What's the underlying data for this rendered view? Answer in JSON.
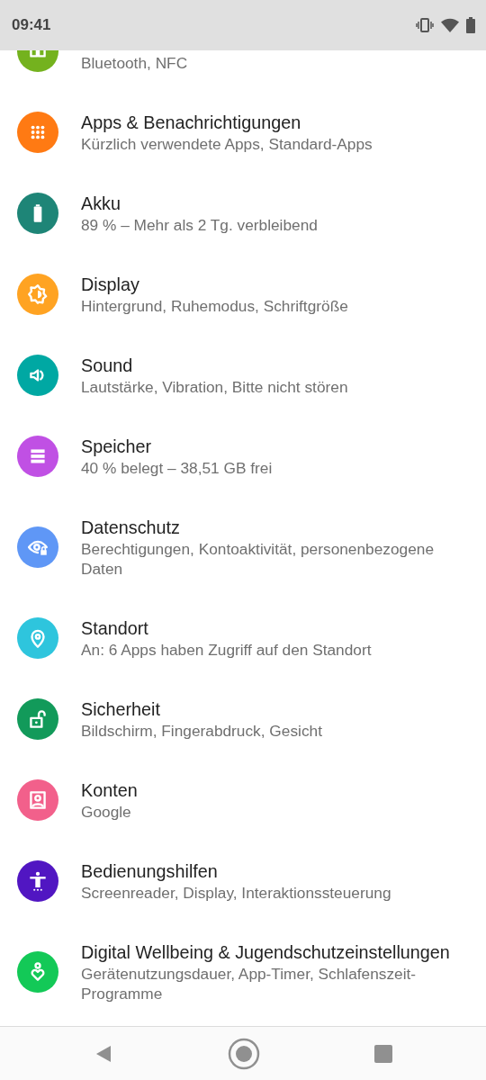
{
  "status_bar": {
    "time": "09:41"
  },
  "settings": [
    {
      "subtitle": "Bluetooth, NFC",
      "color": "#74b21e"
    },
    {
      "title": "Apps & Benachrichtigungen",
      "subtitle": "Kürzlich verwendete Apps, Standard-Apps",
      "color": "#ff7a13"
    },
    {
      "title": "Akku",
      "subtitle": "89 % – Mehr als 2 Tg. verbleibend",
      "color": "#1e8577"
    },
    {
      "title": "Display",
      "subtitle": "Hintergrund, Ruhemodus, Schriftgröße",
      "color": "#ffa322"
    },
    {
      "title": "Sound",
      "subtitle": "Lautstärke, Vibration, Bitte nicht stören",
      "color": "#00a8a3"
    },
    {
      "title": "Speicher",
      "subtitle": "40 % belegt – 38,51 GB frei",
      "color": "#c050e4"
    },
    {
      "title": "Datenschutz",
      "subtitle": "Berechtigungen, Kontoaktivität, personenbezogene Daten",
      "color": "#5f97f6"
    },
    {
      "title": "Standort",
      "subtitle": "An: 6 Apps haben Zugriff auf den Standort",
      "color": "#2ec5dd"
    },
    {
      "title": "Sicherheit",
      "subtitle": "Bildschirm, Fingerabdruck, Gesicht",
      "color": "#129a5a"
    },
    {
      "title": "Konten",
      "subtitle": "Google",
      "color": "#f2608b"
    },
    {
      "title": "Bedienungshilfen",
      "subtitle": "Screenreader, Display, Interaktionssteuerung",
      "color": "#5116c2"
    },
    {
      "title": "Digital Wellbeing & Jugendschutzeinstellungen",
      "subtitle": "Gerätenutzungsdauer, App-Timer, Schlafenszeit-Programme",
      "color": "#13c957"
    }
  ]
}
